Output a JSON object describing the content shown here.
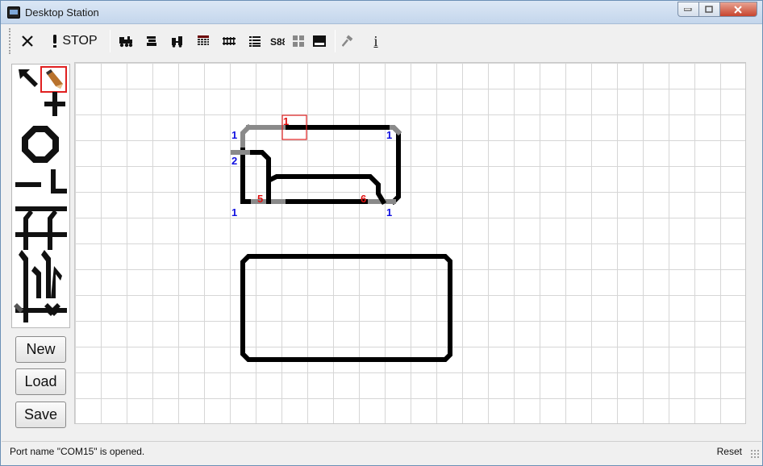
{
  "window": {
    "title": "Desktop Station"
  },
  "toolbar": {
    "stop_label": "STOP",
    "info_label": "i"
  },
  "sidebar": {
    "new_label": "New",
    "load_label": "Load",
    "save_label": "Save"
  },
  "layout_labels": {
    "top_left": "1",
    "top_right": "1",
    "left_mid": "2",
    "bottom_left": "1",
    "bottom_right": "1",
    "selected": "1",
    "switch_a": "5",
    "switch_b": "6"
  },
  "status": {
    "message": "Port name \"COM15\" is opened.",
    "reset_label": "Reset"
  },
  "colors": {
    "track": "#000000",
    "track_selected": "#8a8a8a",
    "label_blue": "#1010e0",
    "label_red": "#e01010",
    "selection": "#e02020"
  }
}
